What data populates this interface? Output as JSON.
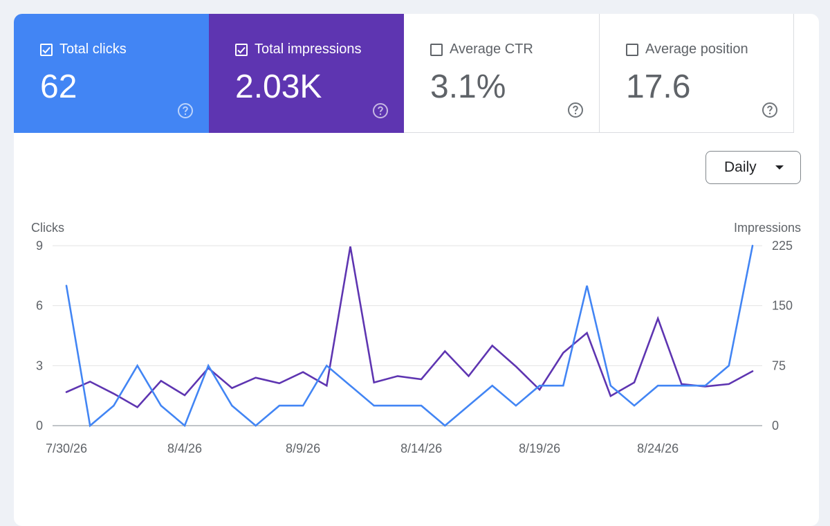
{
  "metrics": {
    "clicks": {
      "label": "Total clicks",
      "value": "62",
      "checked": true,
      "color": "#4285f4"
    },
    "impressions": {
      "label": "Total impressions",
      "value": "2.03K",
      "checked": true,
      "color": "#5e35b1"
    },
    "ctr": {
      "label": "Average CTR",
      "value": "3.1%",
      "checked": false
    },
    "position": {
      "label": "Average position",
      "value": "17.6",
      "checked": false
    }
  },
  "icons": {
    "checkbox": "checkbox-icon",
    "help": "help-circle-icon",
    "dropdown": "arrow-drop-down-icon"
  },
  "period_select": {
    "label": "Daily"
  },
  "chart_data": {
    "type": "line",
    "x": [
      "7/30/26",
      "7/31/26",
      "8/1/26",
      "8/2/26",
      "8/3/26",
      "8/4/26",
      "8/5/26",
      "8/6/26",
      "8/7/26",
      "8/8/26",
      "8/9/26",
      "8/10/26",
      "8/11/26",
      "8/12/26",
      "8/13/26",
      "8/14/26",
      "8/15/26",
      "8/16/26",
      "8/17/26",
      "8/18/26",
      "8/19/26",
      "8/20/26",
      "8/21/26",
      "8/22/26",
      "8/23/26",
      "8/24/26",
      "8/25/26",
      "8/26/26",
      "8/27/26",
      "8/28/26"
    ],
    "x_tick_labels": [
      "7/30/26",
      "8/4/26",
      "8/9/26",
      "8/14/26",
      "8/19/26",
      "8/24/26"
    ],
    "x_tick_indices": [
      0,
      5,
      10,
      15,
      20,
      25
    ],
    "y_left": {
      "label": "Clicks",
      "ticks": [
        0,
        3,
        6,
        9
      ],
      "range": [
        0,
        9
      ]
    },
    "y_right": {
      "label": "Impressions",
      "ticks": [
        0,
        75,
        150,
        225
      ],
      "range": [
        0,
        225
      ]
    },
    "grid": true,
    "series": [
      {
        "name": "Total clicks",
        "axis": "left",
        "color": "#4285f4",
        "values": [
          7,
          0,
          1,
          3,
          1,
          0,
          3,
          1,
          0,
          1,
          1,
          3,
          2,
          1,
          1,
          1,
          0,
          1,
          2,
          1,
          2,
          2,
          7,
          2,
          1,
          2,
          2,
          2,
          3,
          9
        ]
      },
      {
        "name": "Total impressions",
        "axis": "right",
        "color": "#5e35b1",
        "values": [
          42,
          55,
          40,
          23,
          56,
          38,
          72,
          47,
          60,
          53,
          67,
          50,
          224,
          54,
          62,
          58,
          93,
          62,
          100,
          74,
          45,
          91,
          116,
          37,
          54,
          134,
          52,
          49,
          52,
          68
        ]
      }
    ]
  }
}
